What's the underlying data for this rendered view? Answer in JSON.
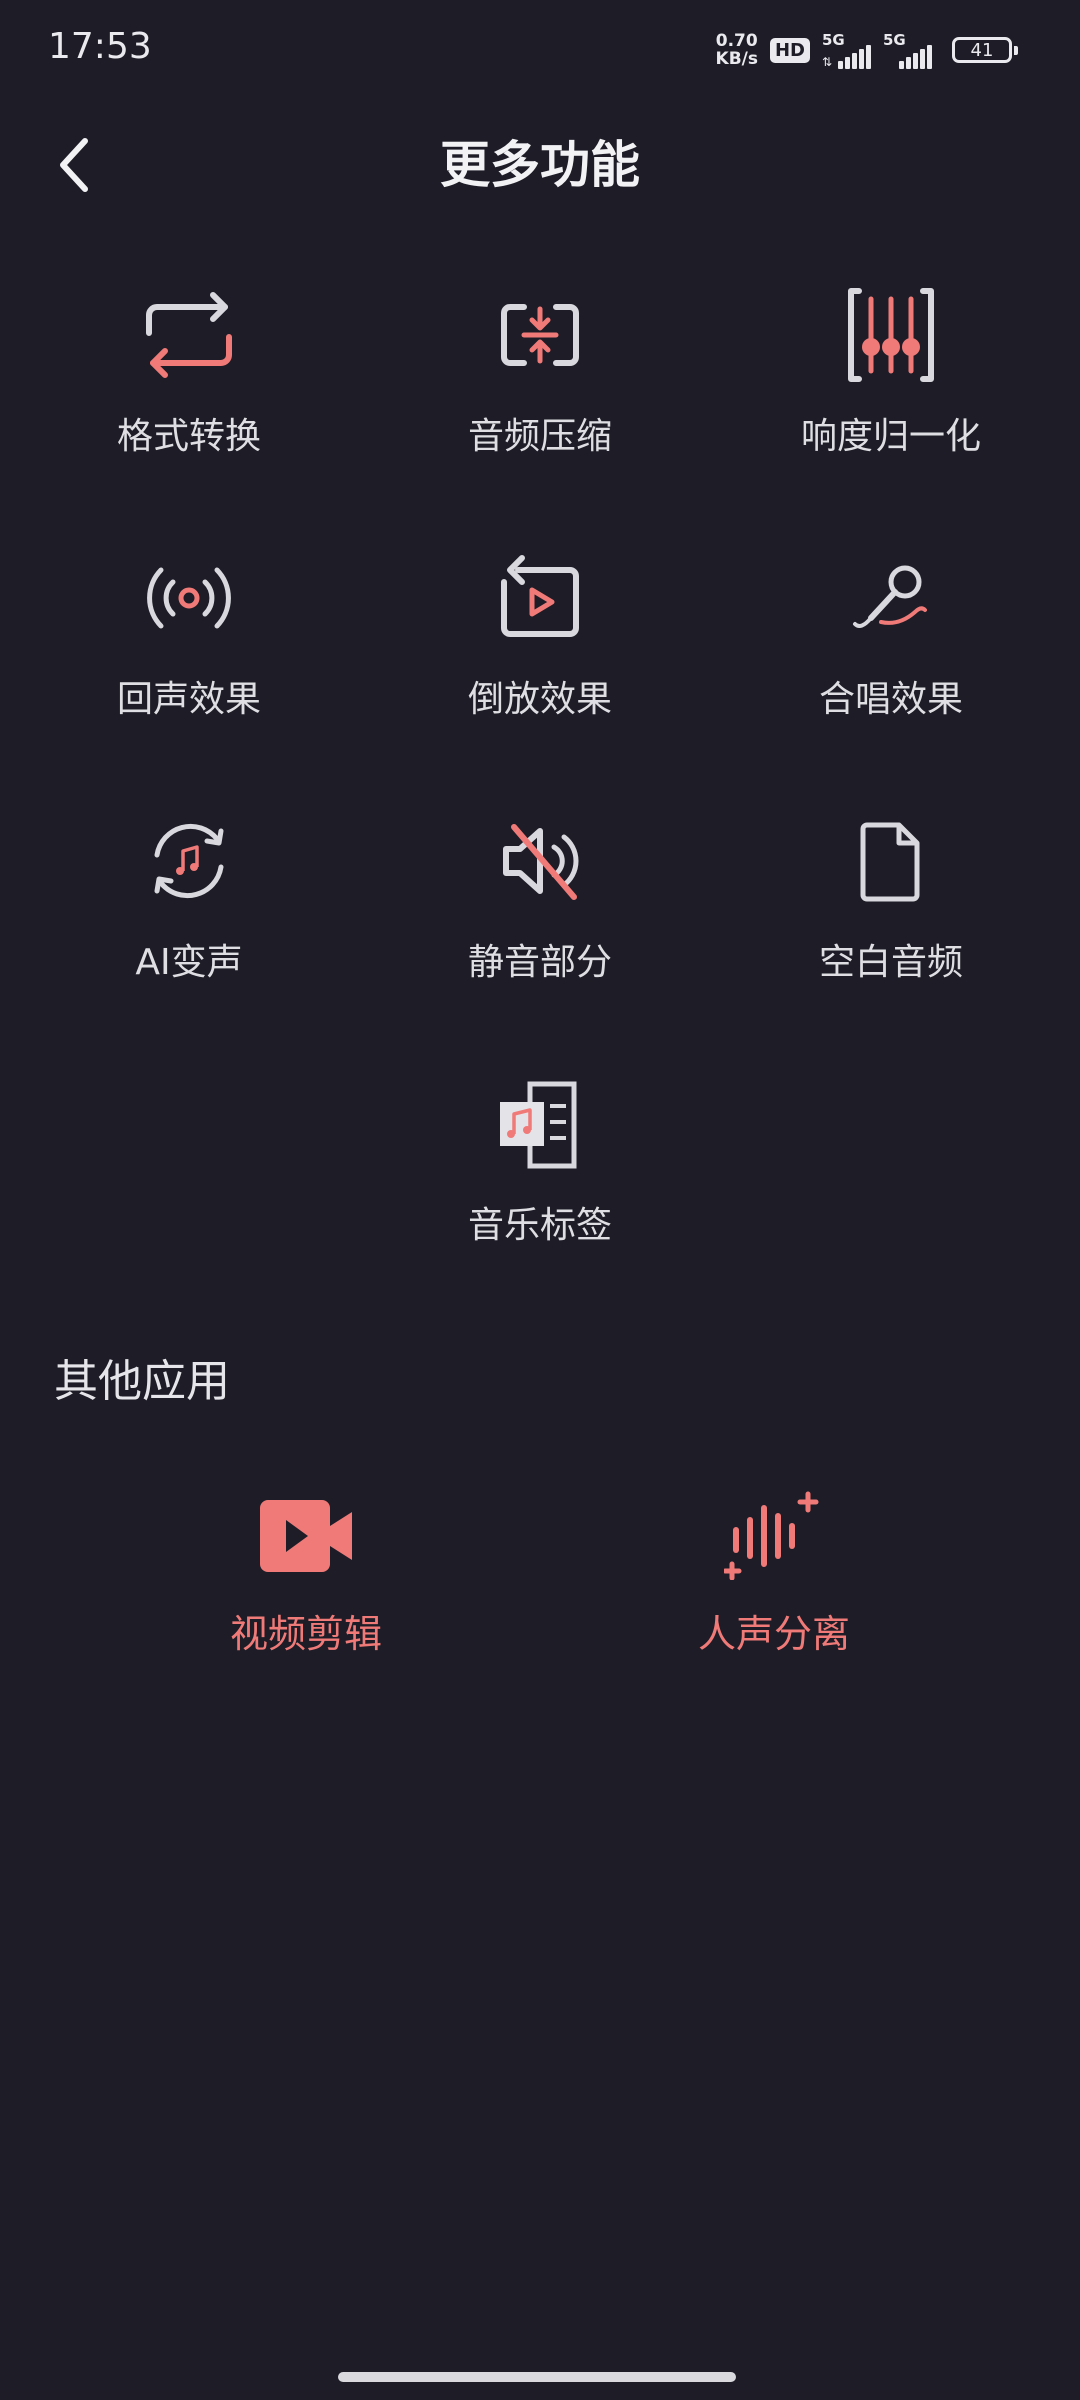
{
  "status_bar": {
    "time": "17:53",
    "net_speed_value": "0.70",
    "net_speed_unit": "KB/s",
    "hd_badge": "HD",
    "signal1_label": "5G",
    "signal2_label": "5G",
    "battery": "41"
  },
  "header": {
    "title": "更多功能"
  },
  "features": [
    {
      "label": "格式转换",
      "icon": "format-convert-icon"
    },
    {
      "label": "音频压缩",
      "icon": "audio-compress-icon"
    },
    {
      "label": "响度归一化",
      "icon": "loudness-normalize-icon"
    },
    {
      "label": "回声效果",
      "icon": "echo-icon"
    },
    {
      "label": "倒放效果",
      "icon": "reverse-play-icon"
    },
    {
      "label": "合唱效果",
      "icon": "chorus-mic-icon"
    },
    {
      "label": "AI变声",
      "icon": "ai-voice-change-icon"
    },
    {
      "label": "静音部分",
      "icon": "mute-icon"
    },
    {
      "label": "空白音频",
      "icon": "blank-file-icon"
    },
    {
      "label": "音乐标签",
      "icon": "music-tag-icon"
    }
  ],
  "other_apps": {
    "title": "其他应用",
    "items": [
      {
        "label": "视频剪辑",
        "icon": "video-camera-icon"
      },
      {
        "label": "人声分离",
        "icon": "vocal-separation-icon"
      }
    ]
  },
  "colors": {
    "background": "#1e1d27",
    "accent": "#f07a78",
    "icon_stroke": "#d8d8de"
  }
}
